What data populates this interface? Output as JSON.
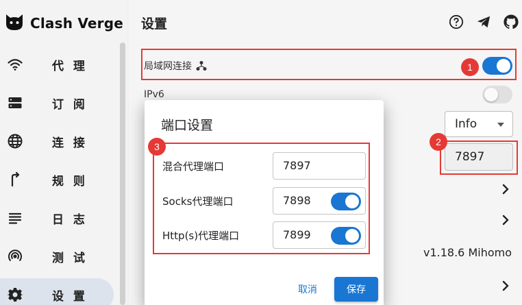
{
  "app": {
    "name": "Clash Verge"
  },
  "sidebar": {
    "items": [
      {
        "label": "代 理",
        "icon": "wifi-icon"
      },
      {
        "label": "订 阅",
        "icon": "server-icon"
      },
      {
        "label": "连 接",
        "icon": "globe-icon"
      },
      {
        "label": "规 则",
        "icon": "route-icon"
      },
      {
        "label": "日 志",
        "icon": "list-icon"
      },
      {
        "label": "测 试",
        "icon": "radar-icon"
      },
      {
        "label": "设 置",
        "icon": "gear-icon",
        "active": true
      }
    ]
  },
  "header": {
    "title": "设置",
    "icons": [
      "help-icon",
      "telegram-icon",
      "github-icon"
    ]
  },
  "settings": {
    "lan_label": "局域网连接",
    "lan_enabled": true,
    "ipv6_label": "IPv6",
    "ipv6_enabled": false,
    "log_level": "Info",
    "mixed_port": "7897",
    "version": "v1.18.6 Mihomo"
  },
  "dialog": {
    "title": "端口设置",
    "rows": [
      {
        "label": "混合代理端口",
        "value": "7897",
        "has_toggle": false
      },
      {
        "label": "Socks代理端口",
        "value": "7898",
        "has_toggle": true,
        "enabled": true
      },
      {
        "label": "Http(s)代理端口",
        "value": "7899",
        "has_toggle": true,
        "enabled": true
      }
    ],
    "cancel_label": "取消",
    "save_label": "保存"
  },
  "annotations": {
    "badge1": "1",
    "badge2": "2",
    "badge3": "3",
    "color": "#e53935"
  },
  "colors": {
    "accent": "#1976d2"
  }
}
